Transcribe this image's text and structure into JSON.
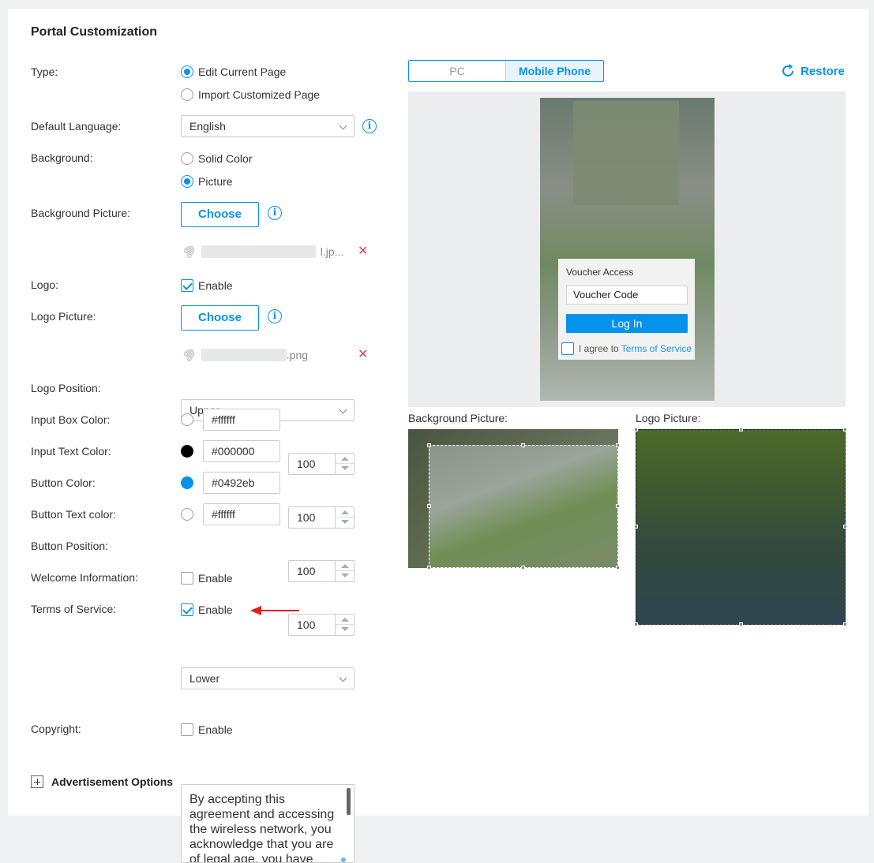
{
  "title": "Portal Customization",
  "fields": {
    "type_label": "Type:",
    "type_opt1": "Edit Current Page",
    "type_opt2": "Import Customized Page",
    "lang_label": "Default Language:",
    "lang_value": "English",
    "bg_label": "Background:",
    "bg_opt1": "Solid Color",
    "bg_opt2": "Picture",
    "bg_pic_label": "Background Picture:",
    "choose": "Choose",
    "bg_file_suffix": "l.jp...",
    "logo_label": "Logo:",
    "enable": "Enable",
    "logo_pic_label": "Logo Picture:",
    "logo_file_suffix": ".png",
    "logo_pos_label": "Logo Position:",
    "logo_pos_value": "Upper",
    "input_box_color_label": "Input Box Color:",
    "input_box_color": "#ffffff",
    "input_box_opacity": "100",
    "input_text_color_label": "Input Text Color:",
    "input_text_color": "#000000",
    "input_text_opacity": "100",
    "button_color_label": "Button Color:",
    "button_color": "#0492eb",
    "button_opacity": "100",
    "button_text_color_label": "Button Text color:",
    "button_text_color": "#ffffff",
    "button_text_opacity": "100",
    "button_pos_label": "Button Position:",
    "button_pos_value": "Lower",
    "welcome_label": "Welcome Information:",
    "tos_label": "Terms of Service:",
    "tos_text": "By accepting this agreement and accessing the wireless network, you acknowledge that you are of legal age, you have",
    "copyright_label": "Copyright:",
    "adv_label": "Advertisement Options"
  },
  "preview": {
    "tab_pc": "PC",
    "tab_mobile": "Mobile Phone",
    "restore": "Restore",
    "voucher_title": "Voucher Access",
    "voucher_placeholder": "Voucher Code",
    "login": "Log In",
    "agree_text": "I agree to",
    "tos_link": "Terms of Service",
    "bg_pic_caption": "Background Picture:",
    "logo_pic_caption": "Logo Picture:"
  },
  "colors": {
    "accent": "#0492eb",
    "delete": "#e8414a",
    "arrow": "#e02020"
  }
}
